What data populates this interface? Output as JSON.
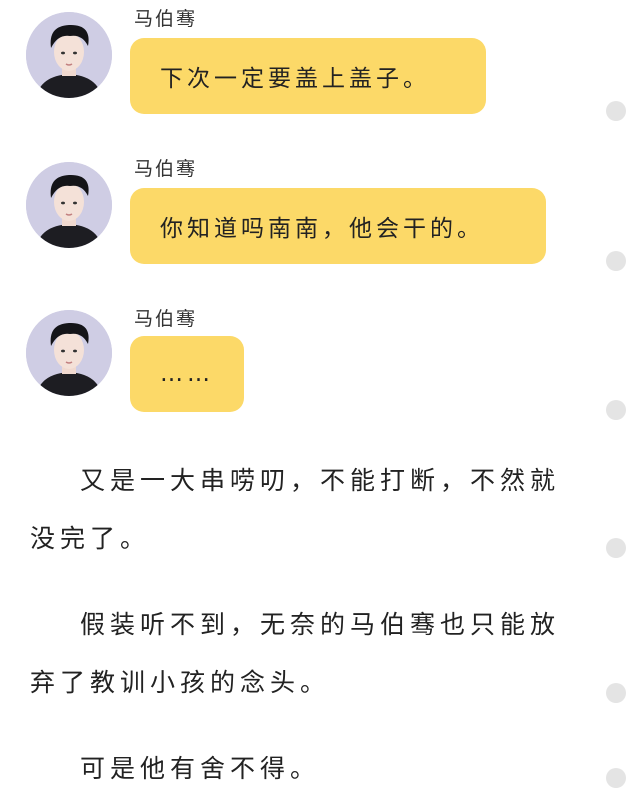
{
  "colors": {
    "bubble": "#fcd968",
    "dot": "#e4e4e4",
    "avatar_bg": "#cfcde4"
  },
  "messages": [
    {
      "sender": "马伯骞",
      "text": "下次一定要盖上盖子。"
    },
    {
      "sender": "马伯骞",
      "text": "你知道吗南南，他会干的。"
    },
    {
      "sender": "马伯骞",
      "text": "……"
    }
  ],
  "paragraphs": [
    "又是一大串唠叨，不能打断，不然就没完了。",
    "假装听不到，无奈的马伯骞也只能放弃了教训小孩的念头。",
    "可是他有舍不得。"
  ]
}
